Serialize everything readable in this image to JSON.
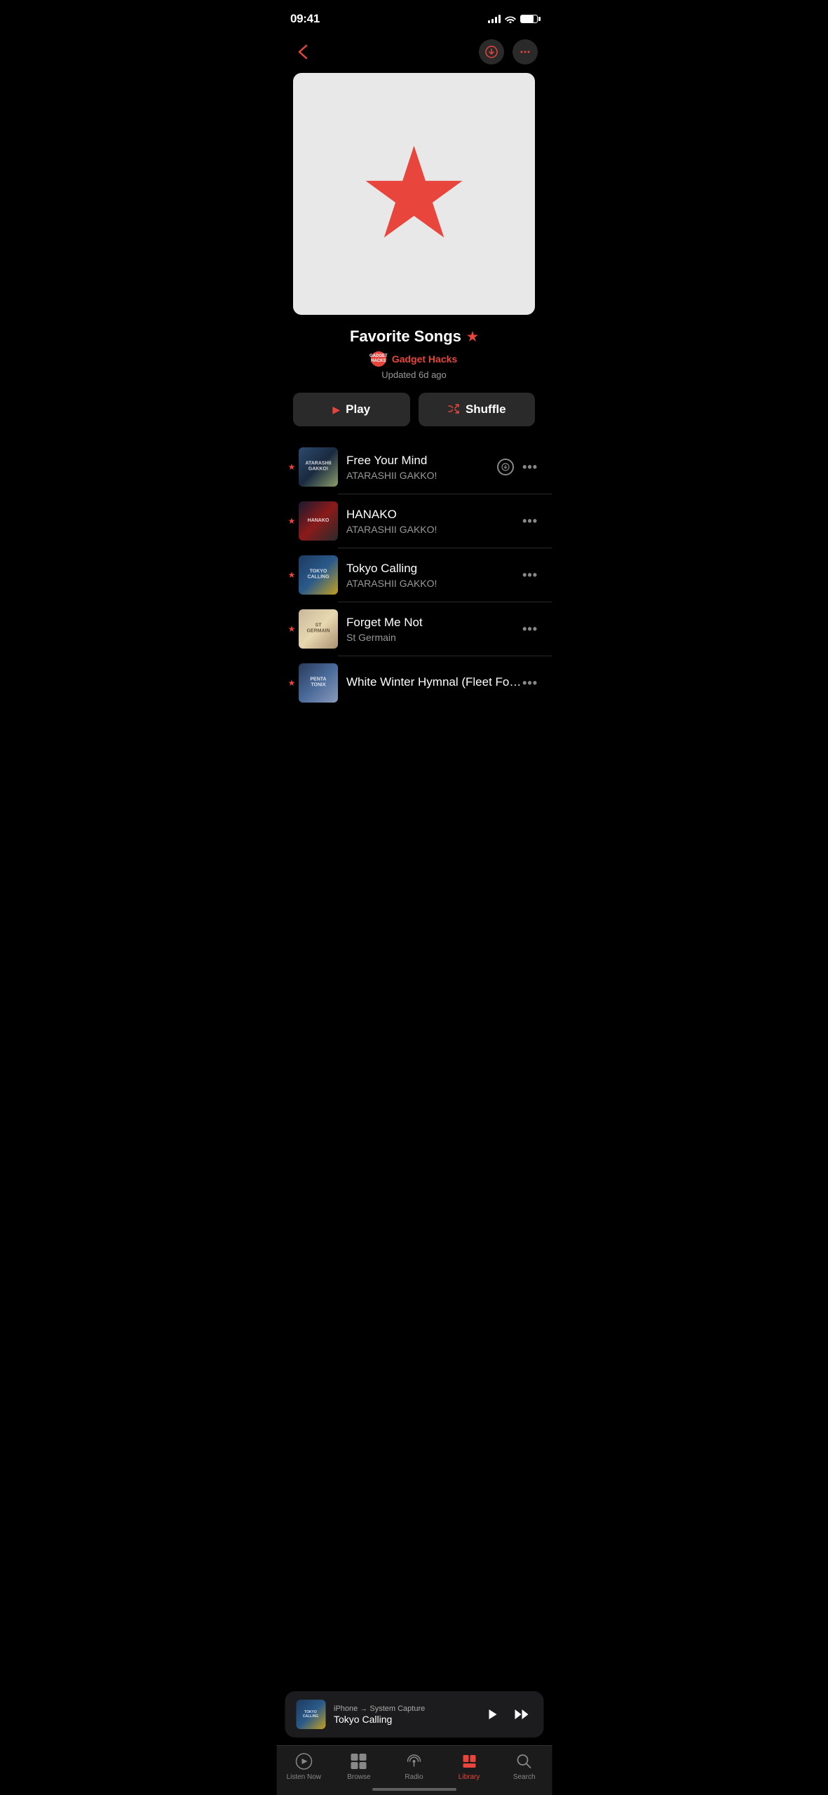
{
  "status_bar": {
    "time": "09:41"
  },
  "nav": {
    "back_label": "‹"
  },
  "playlist": {
    "title": "Favorite Songs",
    "author": "Gadget Hacks",
    "author_initials": "GADGET\nHACKS",
    "updated": "Updated 6d ago"
  },
  "buttons": {
    "play": "Play",
    "shuffle": "Shuffle"
  },
  "songs": [
    {
      "title": "Free Your Mind",
      "artist": "ATARASHII GAKKO!",
      "starred": true,
      "has_download": true
    },
    {
      "title": "HANAKO",
      "artist": "ATARASHII GAKKO!",
      "starred": true,
      "has_download": false
    },
    {
      "title": "Tokyo Calling",
      "artist": "ATARASHII GAKKO!",
      "starred": true,
      "has_download": false
    },
    {
      "title": "Forget Me Not",
      "artist": "St Germain",
      "starred": true,
      "has_download": false
    },
    {
      "title": "White Winter Hymnal (Fleet Foxes Cover)",
      "artist": "",
      "starred": true,
      "has_download": false
    }
  ],
  "now_playing": {
    "source": "iPhone → System Capture",
    "title": "Tokyo Calling"
  },
  "tab_bar": {
    "items": [
      {
        "label": "Listen Now",
        "icon": "play-circle",
        "active": false
      },
      {
        "label": "Browse",
        "icon": "browse",
        "active": false
      },
      {
        "label": "Radio",
        "icon": "radio",
        "active": false
      },
      {
        "label": "Library",
        "icon": "library",
        "active": true
      },
      {
        "label": "Search",
        "icon": "search",
        "active": false
      }
    ]
  }
}
